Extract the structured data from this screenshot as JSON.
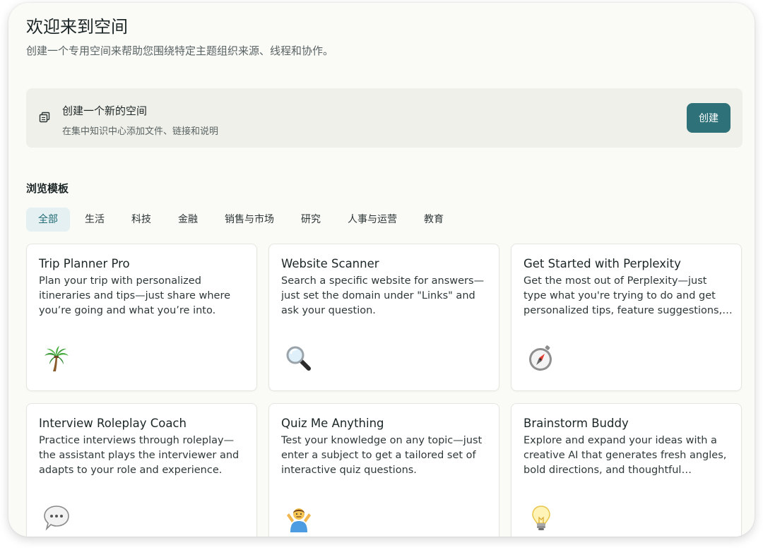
{
  "header": {
    "title": "欢迎来到空间",
    "subtitle": "创建一个专用空间来帮助您围绕特定主题组织来源、线程和协作。"
  },
  "create_space": {
    "title": "创建一个新的空间",
    "description": "在集中知识中心添加文件、链接和说明",
    "button_label": "创建",
    "icon": "stacked-squares-icon"
  },
  "browse": {
    "title": "浏览模板",
    "tabs": [
      {
        "label": "全部",
        "active": true
      },
      {
        "label": "生活"
      },
      {
        "label": "科技"
      },
      {
        "label": "金融"
      },
      {
        "label": "销售与市场"
      },
      {
        "label": "研究"
      },
      {
        "label": "人事与运营"
      },
      {
        "label": "教育"
      }
    ]
  },
  "templates": [
    {
      "title": "Trip Planner Pro",
      "description": "Plan your trip with personalized itineraries and tips—just share where you’re going and what you’re into.",
      "icon": "palm-tree-icon"
    },
    {
      "title": "Website Scanner",
      "description": "Search a specific website for answers—just set the domain under \"Links\" and ask your question.",
      "icon": "magnifying-glass-icon"
    },
    {
      "title": "Get Started with Perplexity",
      "description": "Get the most out of Perplexity—just type what you're trying to do and get personalized tips, feature suggestions, and examples.",
      "icon": "compass-icon"
    },
    {
      "title": "Interview Roleplay Coach",
      "description": "Practice interviews through roleplay—the assistant plays the interviewer and adapts to your role and experience.",
      "icon": "speech-bubble-icon"
    },
    {
      "title": "Quiz Me Anything",
      "description": "Test your knowledge on any topic—just enter a subject to get a tailored set of interactive quiz questions.",
      "icon": "person-shrugging-icon"
    },
    {
      "title": "Brainstorm Buddy",
      "description": "Explore and expand your ideas with a creative AI that generates fresh angles, bold directions, and thoughtful variations.",
      "icon": "light-bulb-icon"
    }
  ],
  "colors": {
    "accent": "#2e7179",
    "active_tab_bg": "#e4f0f1",
    "page_bg": "#fafaf7",
    "panel_bg": "#f0f0ea"
  }
}
